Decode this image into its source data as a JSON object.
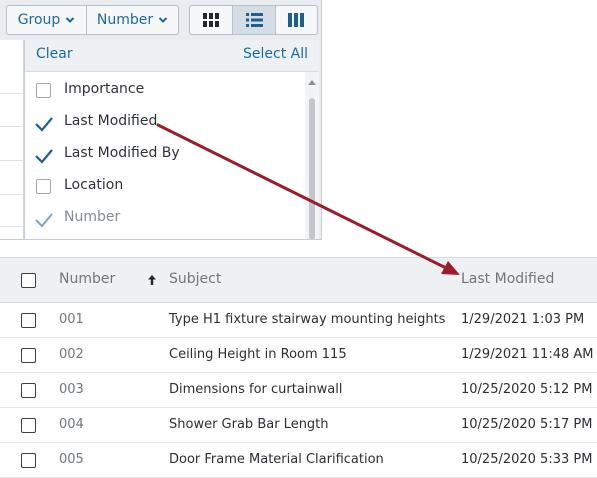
{
  "toolbar": {
    "group_label": "Group",
    "number_label": "Number",
    "view_buttons": [
      {
        "icon": "grid-view-icon",
        "active": false
      },
      {
        "icon": "list-view-icon",
        "active": true
      },
      {
        "icon": "column-view-icon",
        "active": false
      }
    ]
  },
  "dropdown": {
    "clear_label": "Clear",
    "select_all_label": "Select All",
    "items": [
      {
        "label": "Importance",
        "checked": false,
        "disabled": false
      },
      {
        "label": "Last Modified",
        "checked": true,
        "disabled": false
      },
      {
        "label": "Last Modified By",
        "checked": true,
        "disabled": false
      },
      {
        "label": "Location",
        "checked": false,
        "disabled": false
      },
      {
        "label": "Number",
        "checked": true,
        "disabled": true
      }
    ]
  },
  "table": {
    "columns": {
      "number": "Number",
      "subject": "Subject",
      "last_modified": "Last Modified"
    },
    "sort_icon": "sort-up-icon",
    "rows": [
      {
        "number": "001",
        "subject": "Type H1 fixture stairway mounting heights",
        "last_modified": "1/29/2021 1:03 PM"
      },
      {
        "number": "002",
        "subject": "Ceiling Height in Room 115",
        "last_modified": "1/29/2021 11:48 AM"
      },
      {
        "number": "003",
        "subject": "Dimensions for curtainwall",
        "last_modified": "10/25/2020 5:12 PM"
      },
      {
        "number": "004",
        "subject": "Shower Grab Bar Length",
        "last_modified": "10/25/2020 5:17 PM"
      },
      {
        "number": "005",
        "subject": "Door Frame Material Clarification",
        "last_modified": "10/25/2020 5:33 PM"
      }
    ]
  },
  "colors": {
    "link": "#1a6aa0",
    "check": "#1d5f8e",
    "annotation_arrow": "#9b1c2a",
    "header_bg": "#eef1f4"
  }
}
